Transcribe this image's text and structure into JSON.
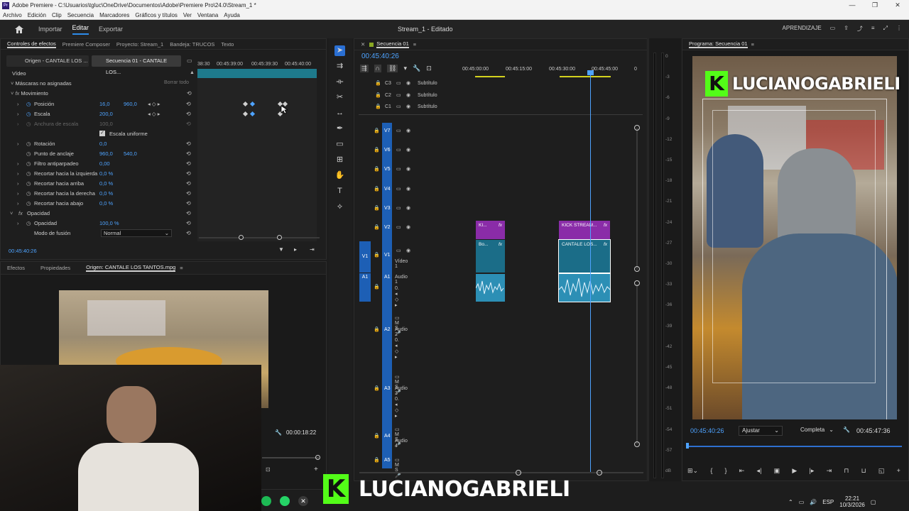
{
  "window": {
    "title": "Adobe Premiere - C:\\Usuarios\\tgluc\\OneDrive\\Documentos\\Adobe\\Premiere Pro\\24.0\\Stream_1 *",
    "app_badge": "Pr",
    "controls": [
      "—",
      "❐",
      "✕"
    ]
  },
  "menu": [
    "Archivo",
    "Edición",
    "Clip",
    "Secuencia",
    "Marcadores",
    "Gráficos y títulos",
    "Ver",
    "Ventana",
    "Ayuda"
  ],
  "header": {
    "tabs": [
      "Importar",
      "Editar",
      "Exportar"
    ],
    "active_tab": "Editar",
    "project_title": "Stream_1 - Editado",
    "learning": "APRENDIZAJE"
  },
  "effect_controls": {
    "tabs": [
      "Controles de efectos",
      "Premiere Composer",
      "Proyecto: Stream_1",
      "Bandeja: TRUCOS",
      "Texto"
    ],
    "source_label": "Origen - CANTALE LOS ...",
    "sequence_label": "Secuencia 01 - CANTALE LOS...",
    "ruler": [
      "38:30",
      "00:45:39:00",
      "00:45:39:30",
      "00:45:40:00"
    ],
    "section_video": "Vídeo",
    "masks": "Máscaras no asignadas",
    "clear_all": "Borrar todo",
    "movement": "Movimiento",
    "rows": [
      {
        "label": "Posición",
        "v1": "16,0",
        "v2": "960,0"
      },
      {
        "label": "Escala",
        "v1": "200,0",
        "v2": ""
      },
      {
        "label": "Anchura de escala",
        "v1": "100,0",
        "v2": ""
      },
      {
        "label": "Escala uniforme",
        "v1": "",
        "v2": ""
      },
      {
        "label": "Rotación",
        "v1": "0,0",
        "v2": ""
      },
      {
        "label": "Punto de anclaje",
        "v1": "960,0",
        "v2": "540,0"
      },
      {
        "label": "Filtro antiparpadeo",
        "v1": "0,00",
        "v2": ""
      },
      {
        "label": "Recortar hacia la izquierda",
        "v1": "0,0 %",
        "v2": ""
      },
      {
        "label": "Recortar hacia arriba",
        "v1": "0,0 %",
        "v2": ""
      },
      {
        "label": "Recortar hacia la derecha",
        "v1": "0,0 %",
        "v2": ""
      },
      {
        "label": "Recortar hacia abajo",
        "v1": "0,0 %",
        "v2": ""
      }
    ],
    "opacity": "Opacidad",
    "opacity_row": {
      "label": "Opacidad",
      "v1": "100,0 %"
    },
    "blend_label": "Modo de fusión",
    "blend_value": "Normal",
    "timecode": "00:45:40:26"
  },
  "source_panel": {
    "tabs": [
      "Efectos",
      "Propiedades",
      "Origen: CANTALE LOS TANTOS.mpg"
    ],
    "timecode": "00:00:18:22"
  },
  "timeline": {
    "tab": "Secuencia 01",
    "timecode": "00:45:40:26",
    "ruler": [
      "00:45:00:00",
      "00:45:15:00",
      "00:45:30:00",
      "00:45:45:00",
      "0"
    ],
    "caption_tracks": [
      {
        "id": "C3",
        "label": "Subtítulo"
      },
      {
        "id": "C2",
        "label": "Subtítulo"
      },
      {
        "id": "C1",
        "label": "Subtítulo"
      }
    ],
    "video_tracks": [
      "V7",
      "V6",
      "V5",
      "V4",
      "V3",
      "V2",
      "V1"
    ],
    "video1_label": "Vídeo 1",
    "audio_tracks": [
      {
        "id": "A1",
        "label": "Audio 1"
      },
      {
        "id": "A2",
        "label": "Audio 2"
      },
      {
        "id": "A3",
        "label": "Audio 3"
      },
      {
        "id": "A4",
        "label": "Audio 4"
      },
      {
        "id": "A5",
        "label": ""
      }
    ],
    "source_patch": {
      "video": "V1",
      "audio": "A1"
    },
    "clips": {
      "v2_a": "KI...",
      "v2_b": "KICK STREAM...",
      "v1_a": "Bo...",
      "v1_b": "CANTALE LOS..."
    },
    "fx": "fx",
    "meter": [
      "0",
      "-3",
      "-6",
      "-9",
      "-12",
      "-15",
      "-18",
      "-21",
      "-24",
      "-27",
      "-30",
      "-33",
      "-36",
      "-39",
      "-42",
      "-45",
      "-48",
      "-51",
      "-54",
      "-57",
      "dB"
    ]
  },
  "program": {
    "tab": "Programa: Secuencia 01",
    "overlay_text": "LUCIANOGABRIELI",
    "timecode_left": "00:45:40:26",
    "fit": "Ajustar",
    "quality": "Completa",
    "timecode_right": "00:45:47:36"
  },
  "webcam_overlay": {
    "text": "LUCIANOGABRIELI"
  },
  "taskbar": {
    "lang": "ESP",
    "time": "22:21",
    "date": "10/3/2026"
  },
  "colors": {
    "accent": "#2d8ceb",
    "clip_purple": "#8a2ca8",
    "clip_teal": "#1b6d88",
    "audio_clip": "#2c8fb5",
    "kick_green": "#53fc18"
  }
}
